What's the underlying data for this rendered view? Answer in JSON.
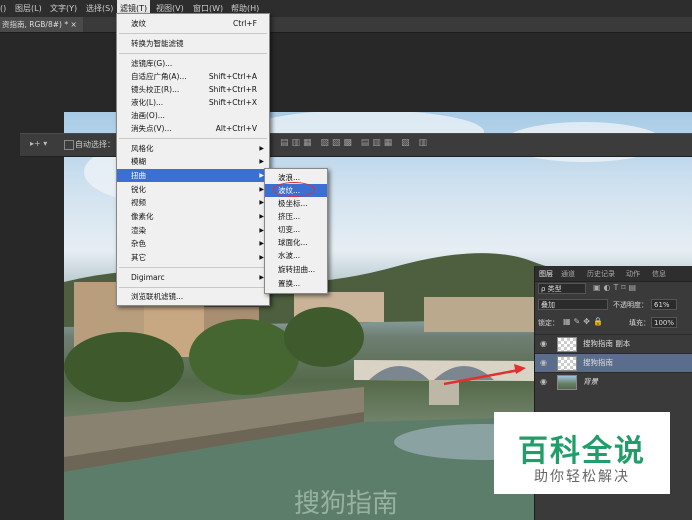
{
  "menubar": {
    "items": [
      "()",
      "图层(L)",
      "文字(Y)",
      "选择(S)",
      "滤镜(T)",
      "视图(V)",
      "窗口(W)",
      "帮助(H)"
    ]
  },
  "document_tab": "资指南, RGB/8#) * ×",
  "options_bar": {
    "auto_select_label": "自动选择："
  },
  "filter_menu": {
    "last_filter": "波纹",
    "last_filter_shortcut": "Ctrl+F",
    "convert_smart": "转换为智能滤镜",
    "filter_gallery": "滤镜库(G)...",
    "adaptive_wide_angle": "自适应广角(A)...",
    "adaptive_wide_angle_shortcut": "Shift+Ctrl+A",
    "lens_correction": "镜头校正(R)...",
    "lens_correction_shortcut": "Shift+Ctrl+R",
    "liquify": "液化(L)...",
    "liquify_shortcut": "Shift+Ctrl+X",
    "oil_paint": "油画(O)...",
    "vanishing_point": "消失点(V)...",
    "vanishing_point_shortcut": "Alt+Ctrl+V",
    "stylize": "风格化",
    "blur": "模糊",
    "distort": "扭曲",
    "sharpen": "锐化",
    "video": "视频",
    "pixelate": "像素化",
    "render": "渲染",
    "noise": "杂色",
    "other": "其它",
    "digimarc": "Digimarc",
    "browse_online": "浏览联机滤镜..."
  },
  "distort_submenu": [
    "波浪...",
    "波纹...",
    "极坐标...",
    "挤压...",
    "切变...",
    "球面化...",
    "水波...",
    "旋转扭曲...",
    "置换..."
  ],
  "layers_panel": {
    "tabs": [
      "图层",
      "通道",
      "历史记录",
      "动作",
      "信息"
    ],
    "filter_kind": "ρ 类型",
    "blend_mode": "叠加",
    "opacity_label": "不透明度：",
    "opacity_value": "61%",
    "lock_label": "锁定：",
    "fill_label": "填充：",
    "fill_value": "100%",
    "layers": [
      {
        "name": "搜狗指南 副本"
      },
      {
        "name": "搜狗指南"
      },
      {
        "name": "背景"
      }
    ]
  },
  "watermark": {
    "title": "百科全说",
    "subtitle": "助你轻松解决"
  },
  "colors": {
    "highlight": "#3c6fd4",
    "watermark_green": "#1f9e6a",
    "arrow_red": "#e03030"
  }
}
